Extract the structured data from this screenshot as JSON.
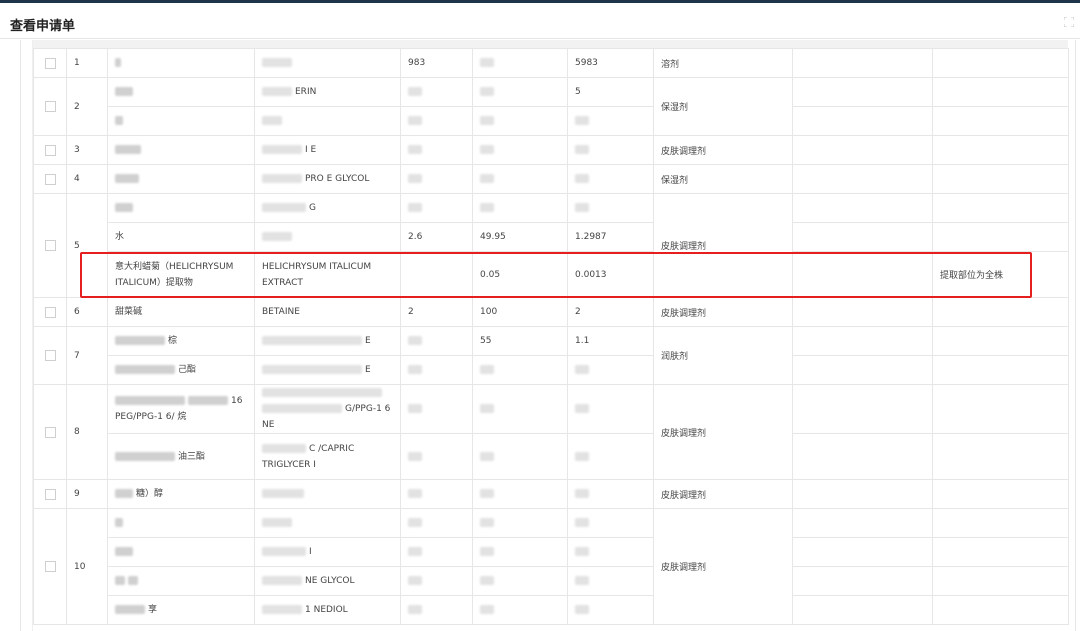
{
  "window": {
    "title": "查看申请单"
  },
  "rows": [
    {
      "idx": "1",
      "func": "溶剂",
      "ingredients": [
        {
          "cn": "",
          "inci": "",
          "c1": "983",
          "c2": "",
          "c3": "5983",
          "note": ""
        }
      ]
    },
    {
      "idx": "2",
      "func": "保湿剂",
      "ingredients": [
        {
          "cn": "",
          "inci": "ERIN",
          "c1": "",
          "c2": "",
          "c3": "5",
          "note": ""
        },
        {
          "cn": "",
          "inci": "",
          "c1": "",
          "c2": "",
          "c3": "",
          "note": ""
        }
      ]
    },
    {
      "idx": "3",
      "func": "皮肤调理剂",
      "ingredients": [
        {
          "cn": "",
          "inci": "I E",
          "c1": "",
          "c2": "",
          "c3": "",
          "note": ""
        }
      ]
    },
    {
      "idx": "4",
      "func": "保湿剂",
      "ingredients": [
        {
          "cn": "",
          "inci": "PRO E GLYCOL",
          "c1": "",
          "c2": "",
          "c3": "",
          "note": ""
        }
      ]
    },
    {
      "idx": "5",
      "func": "皮肤调理剂",
      "ingredients": [
        {
          "cn": "",
          "inci": "G",
          "c1": "",
          "c2": "",
          "c3": "",
          "note": ""
        },
        {
          "cn": "水",
          "inci": "",
          "c1": "2.6",
          "c2": "49.95",
          "c3": "1.2987",
          "note": ""
        },
        {
          "cn": "意大利蜡菊（HELICHRYSUM ITALICUM）提取物",
          "inci": "HELICHRYSUM ITALICUM EXTRACT",
          "c1": "",
          "c2": "0.05",
          "c3": "0.0013",
          "note": "提取部位为全株"
        }
      ]
    },
    {
      "idx": "6",
      "func": "皮肤调理剂",
      "ingredients": [
        {
          "cn": "甜菜碱",
          "inci": "BETAINE",
          "c1": "2",
          "c2": "100",
          "c3": "2",
          "note": ""
        }
      ]
    },
    {
      "idx": "7",
      "func": "润肤剂",
      "ingredients": [
        {
          "cn": "棕",
          "inci": "E",
          "c1": "",
          "c2": "55",
          "c3": "1.1",
          "note": ""
        },
        {
          "cn": "己酯",
          "inci": "E",
          "c1": "",
          "c2": "",
          "c3": "",
          "note": ""
        }
      ]
    },
    {
      "idx": "8",
      "func": "皮肤调理剂",
      "ingredients": [
        {
          "cn": "16 PEG/PPG-1 6/ 烷",
          "inci": "G/PPG-1 6 NE",
          "c1": "",
          "c2": "",
          "c3": "",
          "note": ""
        },
        {
          "cn": "油三酯",
          "inci": "C /CAPRIC TRIGLYCER I",
          "c1": "",
          "c2": "",
          "c3": "",
          "note": ""
        }
      ]
    },
    {
      "idx": "9",
      "func": "皮肤调理剂",
      "ingredients": [
        {
          "cn": "糖）醇",
          "inci": "",
          "c1": "",
          "c2": "",
          "c3": "",
          "note": ""
        }
      ]
    },
    {
      "idx": "10",
      "func": "皮肤调理剂",
      "ingredients": [
        {
          "cn": "",
          "inci": "",
          "c1": "",
          "c2": "",
          "c3": "",
          "note": ""
        },
        {
          "cn": "",
          "inci": "I",
          "c1": "",
          "c2": "",
          "c3": "",
          "note": ""
        },
        {
          "cn": "",
          "inci": "NE GLYCOL",
          "c1": "",
          "c2": "",
          "c3": "",
          "note": ""
        },
        {
          "cn": "享",
          "inci": "1 NEDIOL",
          "c1": "",
          "c2": "",
          "c3": "",
          "note": ""
        }
      ]
    }
  ]
}
